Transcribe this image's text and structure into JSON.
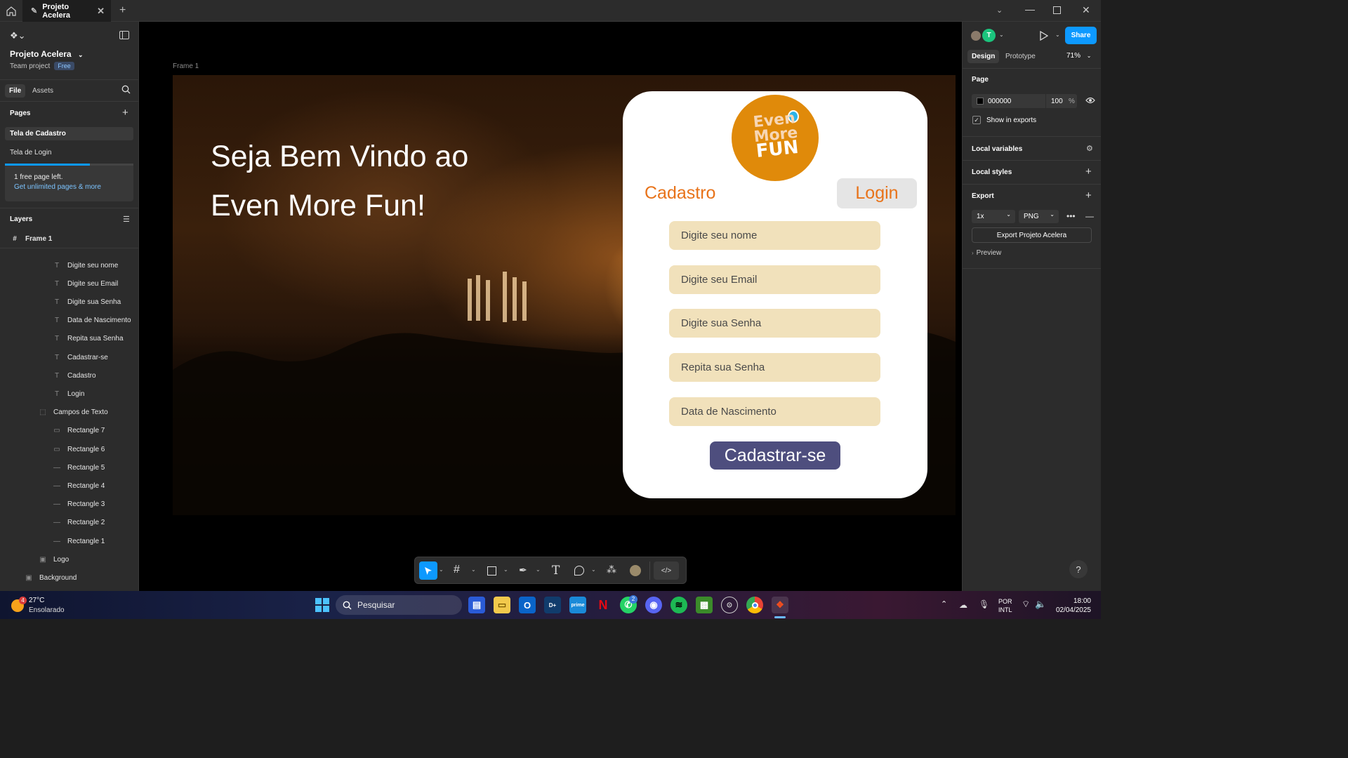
{
  "window": {
    "tab_title": "Projeto Acelera"
  },
  "left": {
    "project_name": "Projeto Acelera",
    "project_type": "Team project",
    "plan_badge": "Free",
    "tabs": {
      "file": "File",
      "assets": "Assets"
    },
    "pages_heading": "Pages",
    "pages": [
      "Tela de Cadastro",
      "Tela de Login"
    ],
    "notice": {
      "text": "1 free page left.",
      "link": "Get unlimited pages & more"
    },
    "layers_heading": "Layers",
    "frame_layer": "Frame 1",
    "layers": [
      {
        "name": "Digite seu nome",
        "kind": "text"
      },
      {
        "name": "Digite seu Email",
        "kind": "text"
      },
      {
        "name": "Digite sua Senha",
        "kind": "text"
      },
      {
        "name": "Data de Nascimento",
        "kind": "text"
      },
      {
        "name": "Repita sua Senha",
        "kind": "text"
      },
      {
        "name": "Cadastrar-se",
        "kind": "text"
      },
      {
        "name": "Cadastro",
        "kind": "text"
      },
      {
        "name": "Login",
        "kind": "text"
      },
      {
        "name": "Campos de Texto",
        "kind": "group"
      },
      {
        "name": "Rectangle 7",
        "kind": "rect"
      },
      {
        "name": "Rectangle 6",
        "kind": "rect"
      },
      {
        "name": "Rectangle 5",
        "kind": "line"
      },
      {
        "name": "Rectangle 4",
        "kind": "line"
      },
      {
        "name": "Rectangle 3",
        "kind": "line"
      },
      {
        "name": "Rectangle 2",
        "kind": "line"
      },
      {
        "name": "Rectangle 1",
        "kind": "line"
      },
      {
        "name": "Logo",
        "kind": "image"
      },
      {
        "name": "Background",
        "kind": "image"
      }
    ]
  },
  "canvas": {
    "frame_label": "Frame 1",
    "headline_1": "Seja Bem Vindo ao",
    "headline_2": "Even More Fun!",
    "logo_text": [
      "Even",
      "More",
      "FUN"
    ],
    "cadastro_label": "Cadastro",
    "login_label": "Login",
    "fields": [
      "Digite seu nome",
      "Digite seu Email",
      "Digite sua Senha",
      "Repita sua Senha",
      "Data de Nascimento"
    ],
    "submit_label": "Cadastrar-se"
  },
  "right": {
    "tabs": {
      "design": "Design",
      "prototype": "Prototype"
    },
    "zoom": "71%",
    "share_label": "Share",
    "avatar_letter": "T",
    "page_heading": "Page",
    "page_color": "000000",
    "page_opacity": "100",
    "percent": "%",
    "show_in_exports": "Show in exports",
    "local_variables": "Local variables",
    "local_styles": "Local styles",
    "export_heading": "Export",
    "export_scale": "1x",
    "export_format": "PNG",
    "export_button": "Export Projeto Acelera",
    "preview": "Preview",
    "help": "?"
  },
  "taskbar": {
    "weather_badge": "4",
    "temperature": "27°C",
    "weather": "Ensolarado",
    "search_placeholder": "Pesquisar",
    "whatsapp_badge": "2",
    "language": "POR",
    "layout": "INTL",
    "time": "18:00",
    "date": "02/04/2025"
  },
  "colors": {
    "accent_blue": "#0d99ff",
    "orange": "#e8731a",
    "field_bg": "#f1e1bb",
    "button_purple": "#4e4e7e",
    "logo_bg": "#e08a0a"
  }
}
